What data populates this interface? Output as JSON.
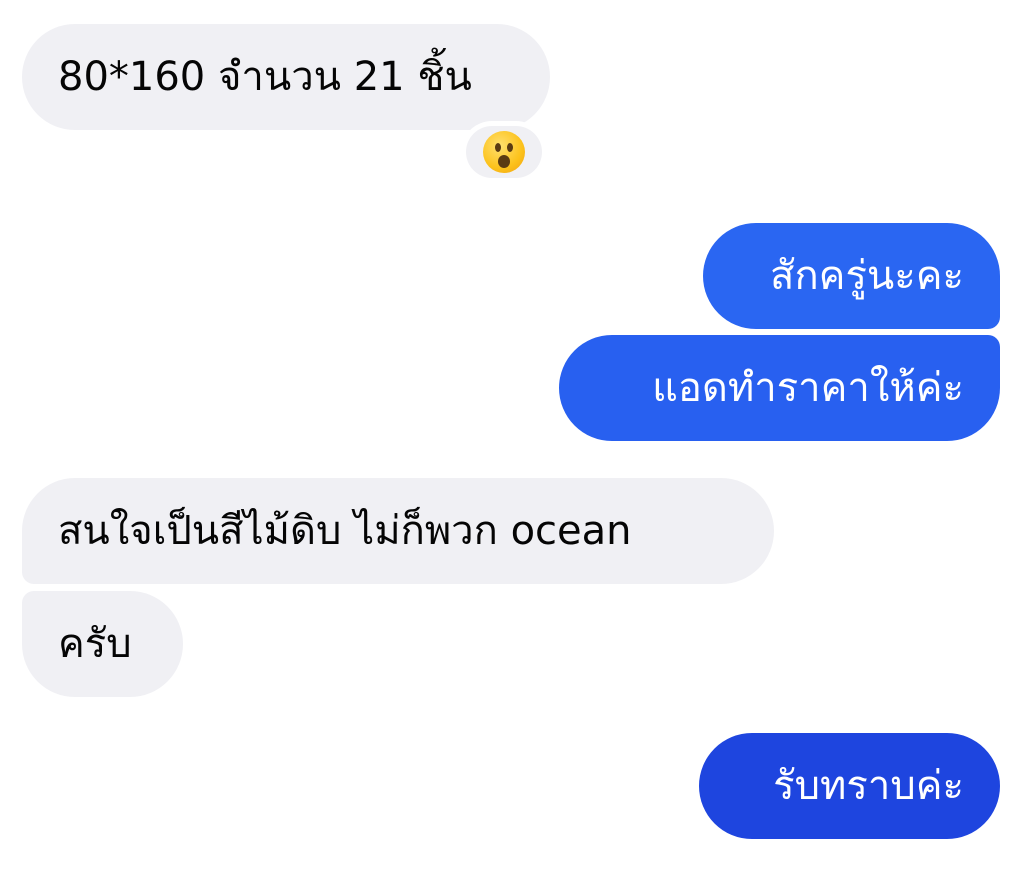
{
  "messages": [
    {
      "id": "m1",
      "direction": "incoming",
      "text": "80*160 จำนวน 21 ชิ้น",
      "reaction": "astonished-face-emoji"
    },
    {
      "id": "m2",
      "direction": "outgoing",
      "text": "สักครู่นะคะ"
    },
    {
      "id": "m3",
      "direction": "outgoing",
      "text": "แอดทำราคาให้ค่ะ"
    },
    {
      "id": "m4",
      "direction": "incoming",
      "text": "สนใจเป็นสีไม้ดิบ ไม่ก็พวก ocean"
    },
    {
      "id": "m5",
      "direction": "incoming",
      "text": "ครับ"
    },
    {
      "id": "m6",
      "direction": "outgoing",
      "text": "รับทราบค่ะ"
    }
  ],
  "colors": {
    "incoming_bubble": "#f0f0f4",
    "incoming_text": "#050505",
    "outgoing_bubble_top": "#2a66f2",
    "outgoing_bubble_mid": "#2860f0",
    "outgoing_bubble_bottom": "#1e45df",
    "outgoing_text": "#ffffff",
    "background": "#ffffff"
  }
}
